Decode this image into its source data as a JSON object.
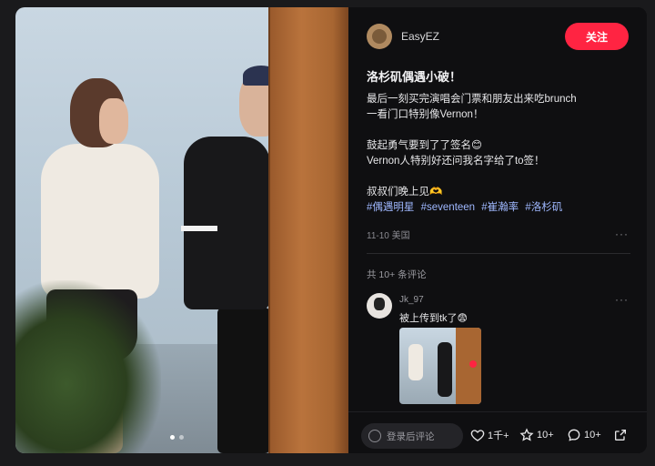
{
  "author": {
    "name": "EasyEZ",
    "follow_label": "关注"
  },
  "post": {
    "title": "洛杉矶偶遇小破！",
    "lines": [
      "最后一刻买完演唱会门票和朋友出来吃brunch",
      "一看门口特别像Vernon！",
      "鼓起勇气要到了了签名😊",
      "Vernon人特别好还问我名字给了to签！",
      "叔叔们晚上见🫶"
    ],
    "tags": [
      "#偶遇明星",
      "#seventeen",
      "#崔瀚率",
      "#洛杉矶"
    ],
    "meta": "11-10 美国",
    "more": "···"
  },
  "comments": {
    "count_label": "共 10+ 条评论",
    "first": {
      "user": "Jk_97",
      "text": "被上传到tk了😨",
      "more": "···"
    }
  },
  "carousel": {
    "total": 2,
    "current": 1
  },
  "bottom": {
    "input_placeholder": "登录后评论",
    "likes": "1千+",
    "collects": "10+",
    "comments": "10+"
  },
  "colors": {
    "accent": "#ff2442",
    "tag": "#9fb8ff"
  }
}
